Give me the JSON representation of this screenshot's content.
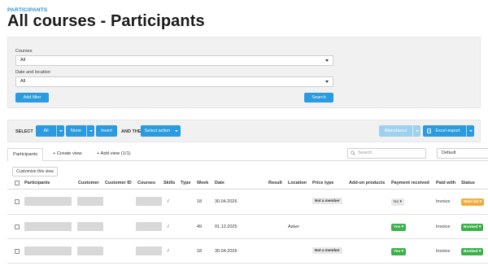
{
  "breadcrumb": "PARTICIPANTS",
  "page_title": "All courses - Participants",
  "filters": {
    "courses_label": "Courses",
    "courses_value": "All",
    "date_location_label": "Date and location",
    "date_location_value": "All",
    "add_filter": "Add filter",
    "search": "Search"
  },
  "select_bar": {
    "select_label": "SELECT",
    "all": "All",
    "none": "None",
    "invert": "Invert",
    "and_then_label": "AND THEN",
    "select_action": "Select action",
    "attendance": "Attendance",
    "excel_export": "Excel export"
  },
  "tabs": {
    "participants": "Participants",
    "create_view": "+ Create view",
    "add_view": "+ Add view (1/1)"
  },
  "search_placeholder": "Search",
  "view_select": "Default",
  "customize": "Customize this view",
  "columns": [
    "Participants",
    "Customer",
    "Customer ID",
    "Courses",
    "Skills",
    "Type",
    "Week",
    "Date",
    "Result",
    "Location",
    "Price type",
    "Add-on products",
    "Payment received",
    "Paid with",
    "Status"
  ],
  "rows": [
    {
      "type": "/",
      "week": "18",
      "date": "30.04.2026",
      "location": "",
      "price_type": "Not a member",
      "payment": "No",
      "paid_with": "Invoice",
      "status": "Wait list"
    },
    {
      "type": "/",
      "week": "49",
      "date": "01.12.2025",
      "location": "Asker",
      "price_type": "",
      "payment": "Yes",
      "paid_with": "Invoice",
      "status": "Booked"
    },
    {
      "type": "/",
      "week": "18",
      "date": "30.04.2026",
      "location": "",
      "price_type": "Not a member",
      "payment": "Yes",
      "paid_with": "Invoice",
      "status": "Booked"
    }
  ],
  "colors": {
    "accent": "#2a9be0",
    "green": "#3cb14a",
    "orange": "#f0ad3e"
  }
}
